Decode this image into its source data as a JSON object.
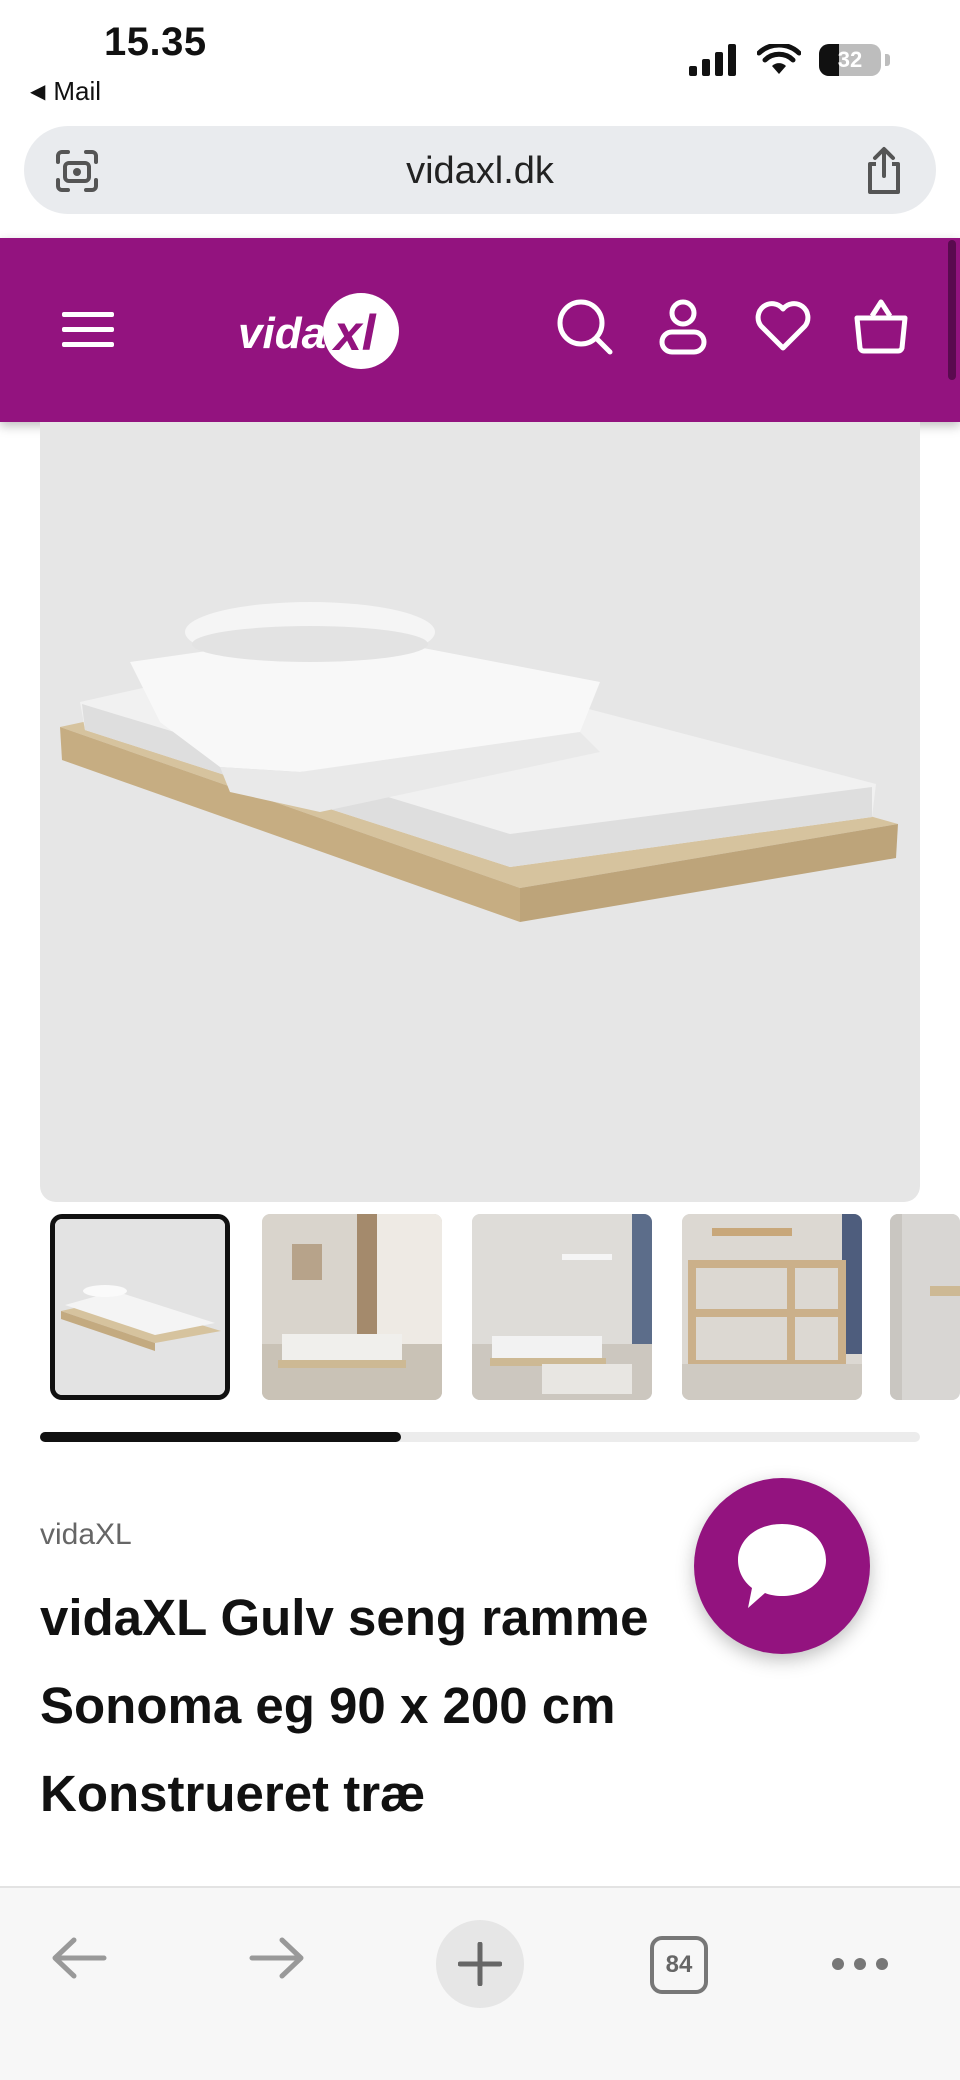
{
  "status_bar": {
    "time": "15.35",
    "back_app": "Mail",
    "battery": "32",
    "battery_level": 0.32
  },
  "browser": {
    "url": "vidaxl.dk",
    "tab_count": "84"
  },
  "colors": {
    "brand": "#93137f",
    "chrome_bg": "#e9ebee"
  },
  "header": {
    "logo_text": "vidaXL",
    "icons": [
      "menu-icon",
      "search-icon",
      "account-icon",
      "wishlist-icon",
      "cart-icon"
    ]
  },
  "gallery": {
    "thumbnail_count_visible": 5,
    "active_index": 0,
    "progress": 0.41
  },
  "product": {
    "brand": "vidaXL",
    "title": "vidaXL Gulv seng ramme Sonoma eg 90 x 200 cm Konstrueret træ"
  },
  "toolbar": {
    "icons": [
      "back-arrow-icon",
      "forward-arrow-icon",
      "plus-icon",
      "tabs-icon",
      "more-icon"
    ]
  }
}
